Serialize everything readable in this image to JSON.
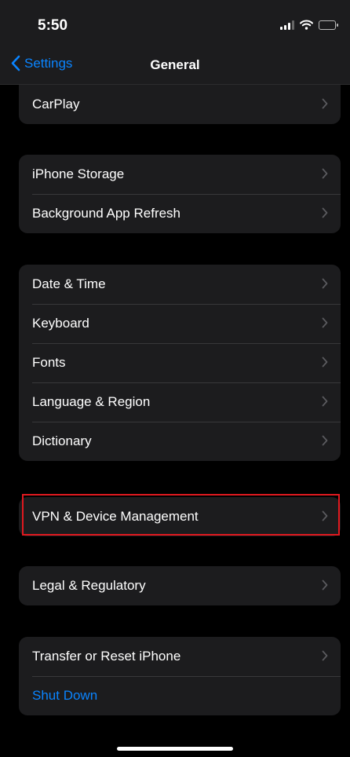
{
  "status": {
    "time": "5:50"
  },
  "nav": {
    "back_label": "Settings",
    "title": "General"
  },
  "groups": [
    {
      "items": [
        "CarPlay"
      ]
    },
    {
      "items": [
        "iPhone Storage",
        "Background App Refresh"
      ]
    },
    {
      "items": [
        "Date & Time",
        "Keyboard",
        "Fonts",
        "Language & Region",
        "Dictionary"
      ]
    },
    {
      "items": [
        "VPN & Device Management"
      ]
    },
    {
      "items": [
        "Legal & Regulatory"
      ]
    },
    {
      "items": [
        "Transfer or Reset iPhone",
        "Shut Down"
      ]
    }
  ],
  "colors": {
    "accent": "#0a84ff",
    "background": "#000000",
    "cell": "#1c1c1e",
    "highlight": "#e0191f"
  }
}
